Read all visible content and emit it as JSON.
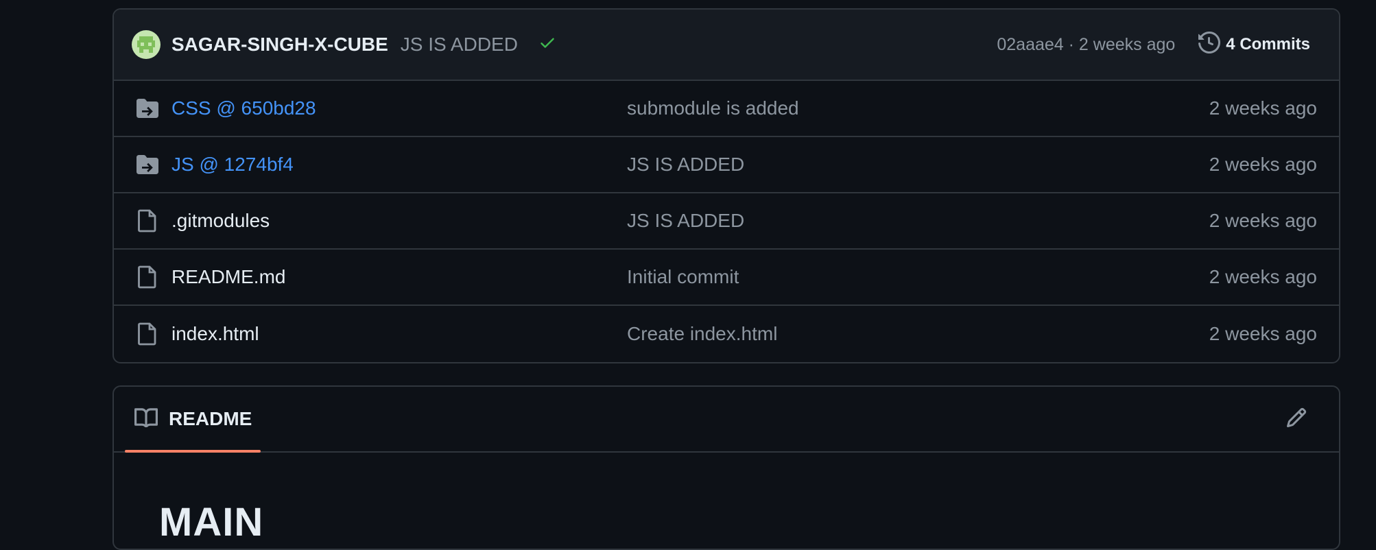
{
  "latest_commit": {
    "author": "SAGAR-SINGH-X-CUBE",
    "message": "JS IS ADDED",
    "status_icon": "check-icon",
    "sha_time": "02aaae4 · 2 weeks ago",
    "commits_label": "4 Commits"
  },
  "files": [
    {
      "icon": "submodule-folder-icon",
      "name": "CSS @ 650bd28",
      "message": "submodule is added",
      "time": "2 weeks ago",
      "is_link": true
    },
    {
      "icon": "submodule-folder-icon",
      "name": "JS @ 1274bf4",
      "message": "JS IS ADDED",
      "time": "2 weeks ago",
      "is_link": true
    },
    {
      "icon": "file-icon",
      "name": ".gitmodules",
      "message": "JS IS ADDED",
      "time": "2 weeks ago",
      "is_link": false
    },
    {
      "icon": "file-icon",
      "name": "README.md",
      "message": "Initial commit",
      "time": "2 weeks ago",
      "is_link": false
    },
    {
      "icon": "file-icon",
      "name": "index.html",
      "message": "Create index.html",
      "time": "2 weeks ago",
      "is_link": false
    }
  ],
  "readme": {
    "tab_label": "README",
    "heading": "MAIN"
  },
  "colors": {
    "background": "#0d1117",
    "border": "#30363d",
    "link": "#4493f8",
    "muted": "#8d96a0",
    "success": "#3fb950",
    "tab_underline": "#f78166"
  }
}
